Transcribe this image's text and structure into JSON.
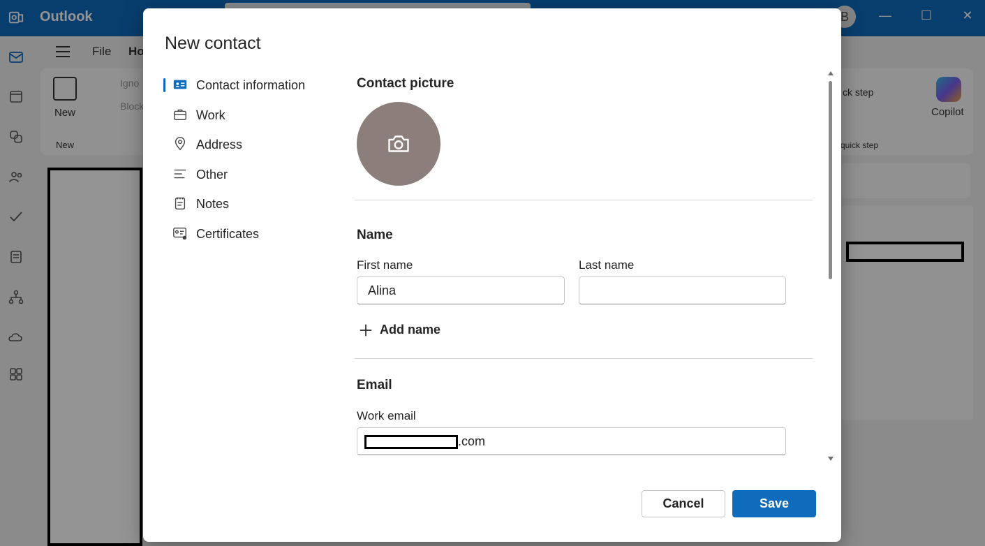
{
  "app": {
    "title": "Outlook",
    "menu": {
      "file": "File",
      "home": "Ho"
    },
    "ribbon": {
      "new_label": "New",
      "new_group": "New",
      "ignore": "Igno",
      "block": "Block",
      "quick_steps": "ck step",
      "quick_steps_group": "quick step",
      "copilot": "Copilot"
    }
  },
  "dialog": {
    "title": "New contact",
    "nav": [
      {
        "label": "Contact information",
        "icon": "contact-card-icon",
        "active": true
      },
      {
        "label": "Work",
        "icon": "briefcase-icon",
        "active": false
      },
      {
        "label": "Address",
        "icon": "location-pin-icon",
        "active": false
      },
      {
        "label": "Other",
        "icon": "text-lines-icon",
        "active": false
      },
      {
        "label": "Notes",
        "icon": "notepad-icon",
        "active": false
      },
      {
        "label": "Certificates",
        "icon": "certificate-icon",
        "active": false
      }
    ],
    "picture": {
      "title": "Contact picture",
      "icon": "camera-icon"
    },
    "name": {
      "title": "Name",
      "first_label": "First name",
      "first_value": "Alina",
      "last_label": "Last name",
      "last_value": "",
      "add_name": "Add name"
    },
    "email": {
      "title": "Email",
      "work_label": "Work email",
      "work_suffix": ".com"
    },
    "buttons": {
      "cancel": "Cancel",
      "save": "Save"
    }
  },
  "colors": {
    "accent": "#0f6cbd",
    "photo_bg": "#8c7e7a"
  }
}
